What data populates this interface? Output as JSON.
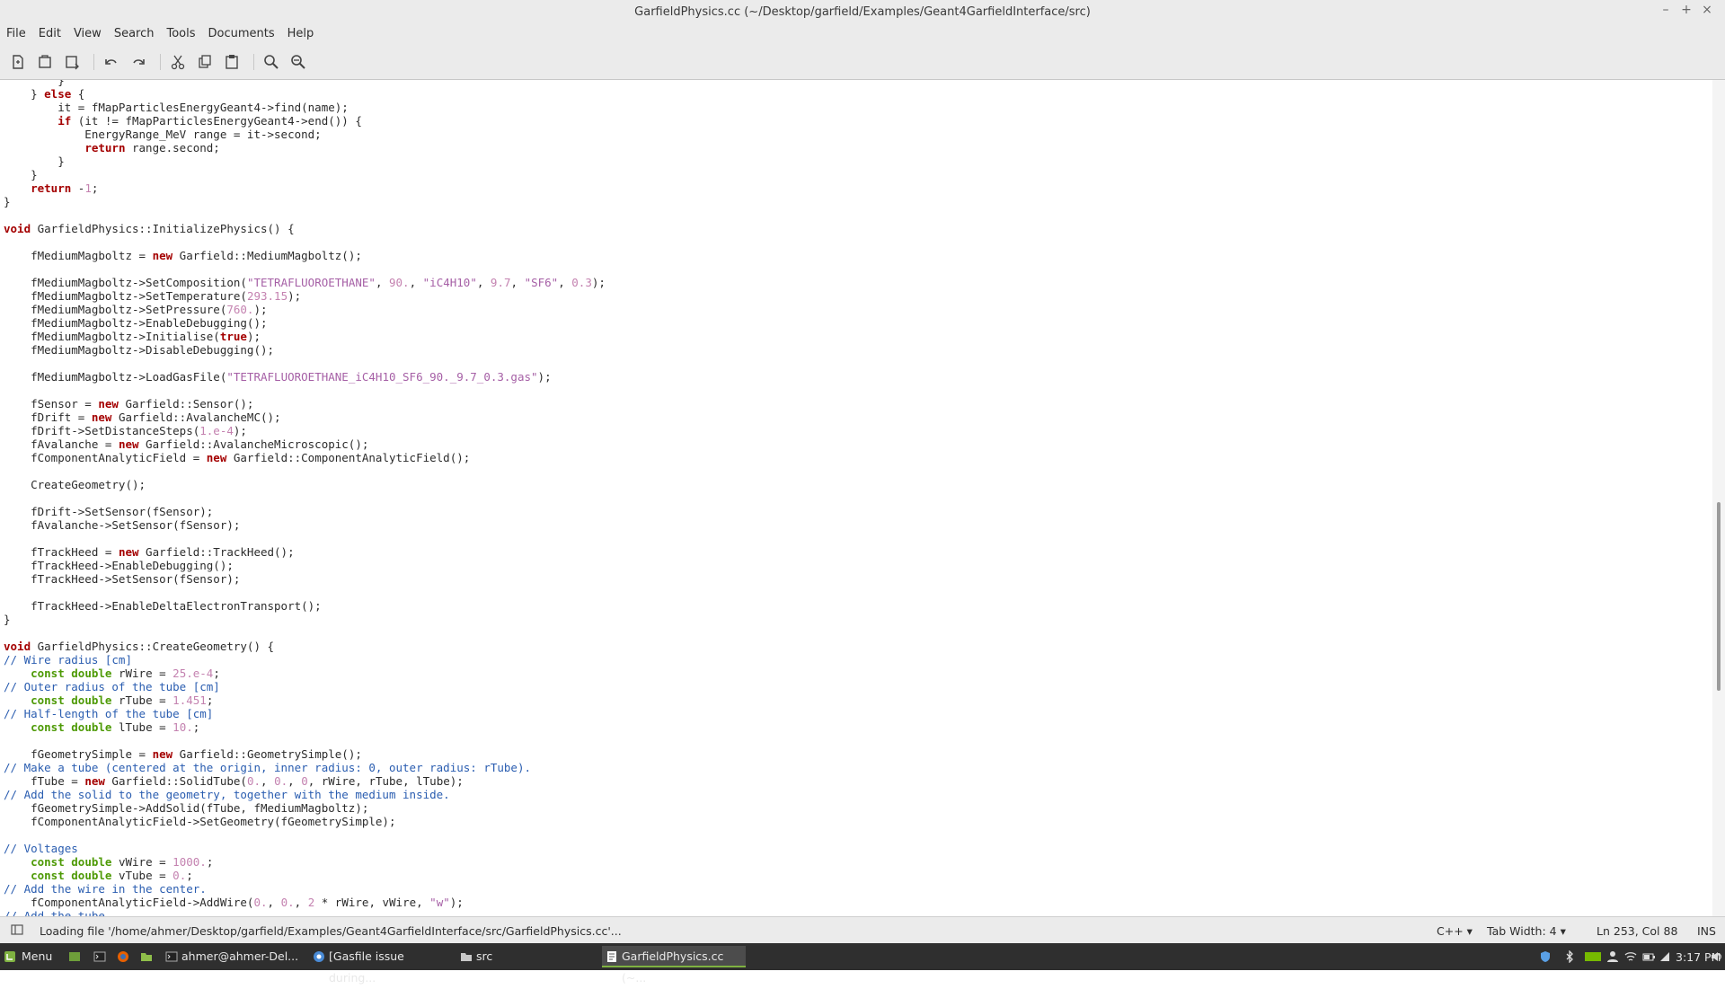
{
  "window": {
    "title": "GarfieldPhysics.cc (~/Desktop/garfield/Examples/Geant4GarfieldInterface/src)"
  },
  "menu": [
    "File",
    "Edit",
    "View",
    "Search",
    "Tools",
    "Documents",
    "Help"
  ],
  "toolbar_icons": [
    "new-document-icon",
    "open-icon",
    "save-icon",
    "undo-icon",
    "redo-icon",
    "cut-icon",
    "copy-icon",
    "paste-icon",
    "find-icon",
    "find-replace-icon"
  ],
  "code_lines": [
    "        }",
    "    } else {",
    "        it = fMapParticlesEnergyGeant4->find(name);",
    "        if (it != fMapParticlesEnergyGeant4->end()) {",
    "            EnergyRange_MeV range = it->second;",
    "            return range.second;",
    "        }",
    "    }",
    "    return -1;",
    "}",
    "",
    "void GarfieldPhysics::InitializePhysics() {",
    "",
    "    fMediumMagboltz = new Garfield::MediumMagboltz();",
    "",
    "    fMediumMagboltz->SetComposition(\"TETRAFLUOROETHANE\", 90., \"iC4H10\", 9.7, \"SF6\", 0.3);",
    "    fMediumMagboltz->SetTemperature(293.15);",
    "    fMediumMagboltz->SetPressure(760.);",
    "    fMediumMagboltz->EnableDebugging();",
    "    fMediumMagboltz->Initialise(true);",
    "    fMediumMagboltz->DisableDebugging();",
    "",
    "    fMediumMagboltz->LoadGasFile(\"TETRAFLUOROETHANE_iC4H10_SF6_90._9.7_0.3.gas\");",
    "",
    "    fSensor = new Garfield::Sensor();",
    "    fDrift = new Garfield::AvalancheMC();",
    "    fDrift->SetDistanceSteps(1.e-4);",
    "    fAvalanche = new Garfield::AvalancheMicroscopic();",
    "    fComponentAnalyticField = new Garfield::ComponentAnalyticField();",
    "",
    "    CreateGeometry();",
    "",
    "    fDrift->SetSensor(fSensor);",
    "    fAvalanche->SetSensor(fSensor);",
    "",
    "    fTrackHeed = new Garfield::TrackHeed();",
    "    fTrackHeed->EnableDebugging();",
    "    fTrackHeed->SetSensor(fSensor);",
    "",
    "    fTrackHeed->EnableDeltaElectronTransport();",
    "}",
    "",
    "void GarfieldPhysics::CreateGeometry() {",
    "// Wire radius [cm]",
    "    const double rWire = 25.e-4;",
    "// Outer radius of the tube [cm]",
    "    const double rTube = 1.451;",
    "// Half-length of the tube [cm]",
    "    const double lTube = 10.;",
    "",
    "    fGeometrySimple = new Garfield::GeometrySimple();",
    "// Make a tube (centered at the origin, inner radius: 0, outer radius: rTube).",
    "    fTube = new Garfield::SolidTube(0., 0., 0, rWire, rTube, lTube);",
    "// Add the solid to the geometry, together with the medium inside.",
    "    fGeometrySimple->AddSolid(fTube, fMediumMagboltz);",
    "    fComponentAnalyticField->SetGeometry(fGeometrySimple);",
    "",
    "// Voltages",
    "    const double vWire = 1000.;",
    "    const double vTube = 0.;",
    "// Add the wire in the center.",
    "    fComponentAnalyticField->AddWire(0., 0., 2 * rWire, vWire, \"w\");",
    "// Add the tube."
  ],
  "status": {
    "message": "Loading file '/home/ahmer/Desktop/garfield/Examples/Geant4GarfieldInterface/src/GarfieldPhysics.cc'...",
    "language": "C++",
    "tab_width": "Tab Width: 4",
    "position": "Ln 253, Col 88",
    "mode": "INS"
  },
  "taskbar": {
    "menu_label": "Menu",
    "tasks": [
      "ahmer@ahmer-Del...",
      "[Gasfile issue during...",
      "src",
      "GarfieldPhysics.cc (~..."
    ],
    "clock": "3:17 PM"
  },
  "colors": {
    "keyword": "#a40000",
    "type": "#4e9a06",
    "number": "#c482b0",
    "string": "#a660a6",
    "comment": "#2a5db0"
  }
}
